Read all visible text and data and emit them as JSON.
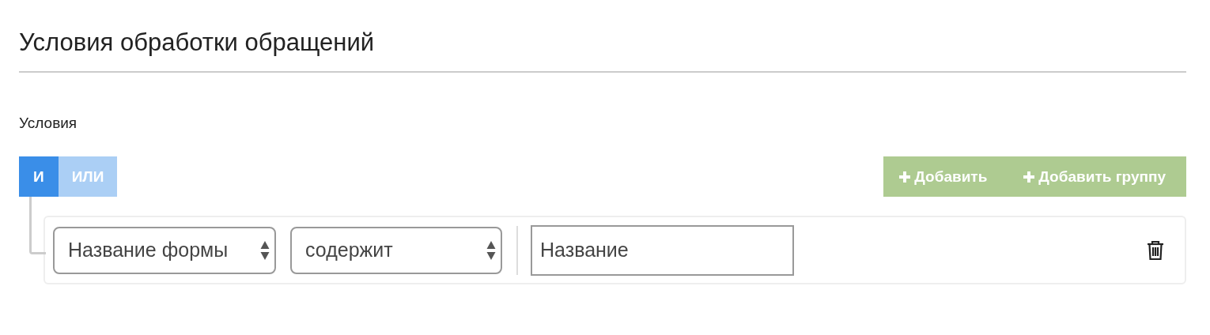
{
  "title": "Условия обработки обращений",
  "section_label": "Условия",
  "conditions_toggle": [
    {
      "label": "И",
      "selected": true
    },
    {
      "label": "ИЛИ",
      "selected": false
    }
  ],
  "add_buttons": [
    {
      "label": "Добавить"
    },
    {
      "label": "Добавить группу"
    }
  ],
  "rules": [
    {
      "field": "Название формы",
      "operator": "содержит",
      "value": "Название"
    }
  ]
}
